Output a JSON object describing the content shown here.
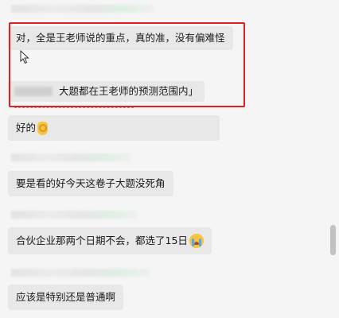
{
  "messages": [
    {
      "type": "text",
      "text": "对，全是王老师说的重点，真的准，没有偏难怪"
    },
    {
      "type": "quote",
      "text": "大题都在王老师的预测范围内」"
    },
    {
      "type": "text",
      "text": "好的",
      "emoji": "ok-hand-emoji"
    },
    {
      "type": "text",
      "text": "要是看的好今天这卷子大题没死角"
    },
    {
      "type": "text",
      "text": "合伙企业那两个日期不会，都选了15日",
      "emoji": "crying-face-emoji"
    },
    {
      "type": "text",
      "text": "应该是特别还是普通啊"
    }
  ],
  "colors": {
    "background": "#f5f5f5",
    "bubble": "#e8e8e8",
    "highlight": "#e02020",
    "scrollbar": "#c2c2c2"
  }
}
